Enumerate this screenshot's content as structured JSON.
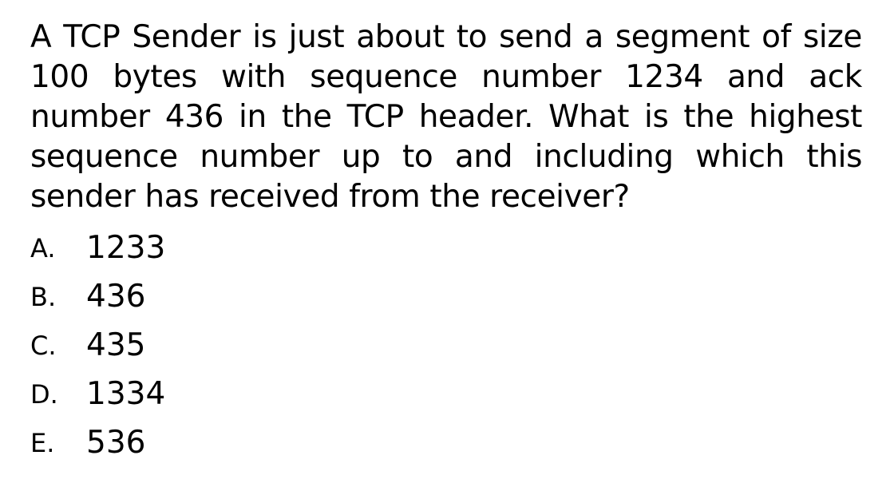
{
  "question": {
    "text": "A TCP Sender is just about to send a segment of size 100 bytes with sequence number 1234 and ack number 436 in the TCP header. What is the highest sequence number up to and including which this sender has received from the receiver?"
  },
  "options": [
    {
      "letter": "A.",
      "value": "1233"
    },
    {
      "letter": "B.",
      "value": "436"
    },
    {
      "letter": "C.",
      "value": "435"
    },
    {
      "letter": "D.",
      "value": "1334"
    },
    {
      "letter": "E.",
      "value": "536"
    }
  ]
}
